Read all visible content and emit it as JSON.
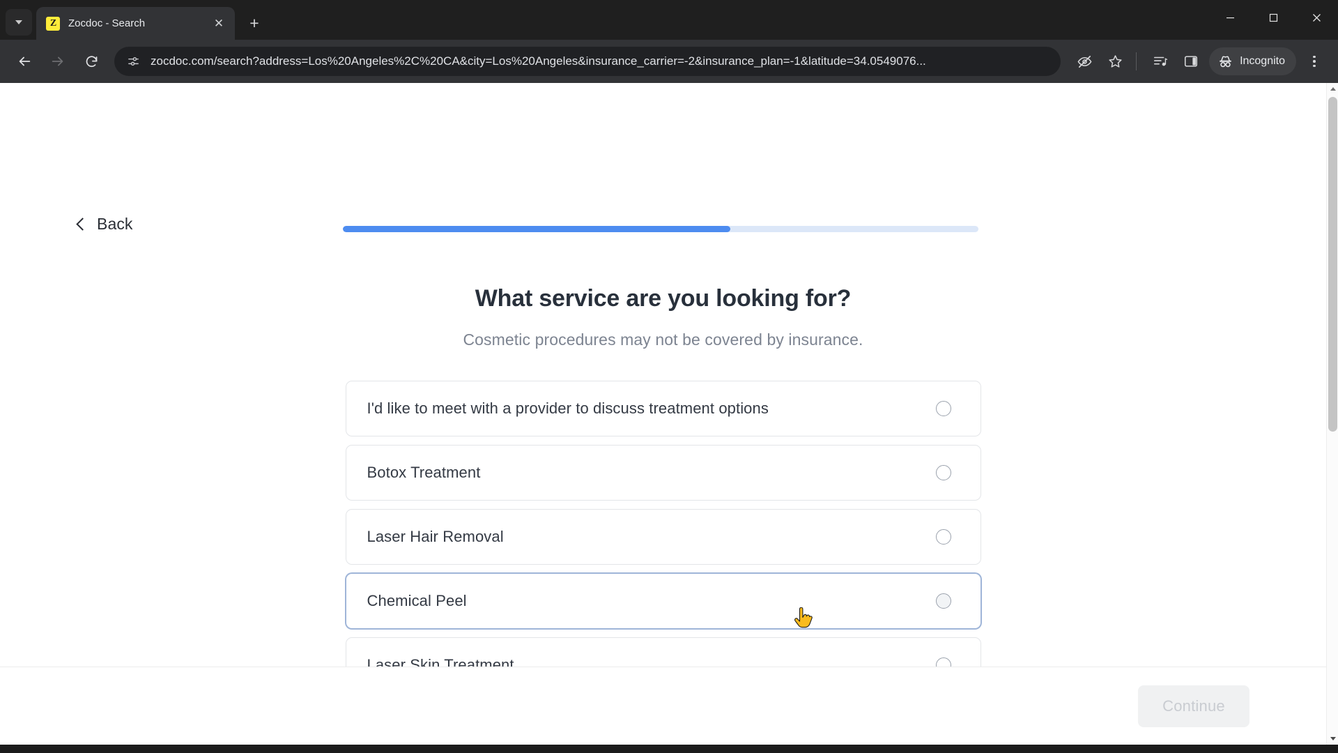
{
  "browser": {
    "tab": {
      "favicon_letter": "Z",
      "title": "Zocdoc - Search",
      "close_icon": "close-icon"
    },
    "new_tab_label": "+",
    "window_controls": {
      "minimize": "minimize-icon",
      "maximize": "maximize-icon",
      "close": "close-icon"
    },
    "toolbar": {
      "back_icon": "back-arrow-icon",
      "forward_icon": "forward-arrow-icon",
      "reload_icon": "reload-icon",
      "site_info_icon": "site-settings-icon",
      "url": "zocdoc.com/search?address=Los%20Angeles%2C%20CA&city=Los%20Angeles&insurance_carrier=-2&insurance_plan=-1&latitude=34.0549076...",
      "tracking_icon": "eye-crossed-icon",
      "bookmark_icon": "star-icon",
      "media_icon": "media-playlist-icon",
      "side_panel_icon": "side-panel-icon",
      "incognito_icon": "incognito-hat-icon",
      "incognito_label": "Incognito",
      "menu_icon": "kebab-menu-icon"
    }
  },
  "page": {
    "back_label": "Back",
    "back_icon": "chevron-left-icon",
    "progress": {
      "percent": 61,
      "fill_color": "#4d8cf0",
      "track_color": "#dce7f8"
    },
    "title": "What service are you looking for?",
    "subtitle": "Cosmetic procedures may not be covered by insurance.",
    "options": [
      {
        "label": "I'd like to meet with a provider to discuss treatment options",
        "selected": false,
        "focused": false
      },
      {
        "label": "Botox Treatment",
        "selected": false,
        "focused": false
      },
      {
        "label": "Laser Hair Removal",
        "selected": false,
        "focused": false
      },
      {
        "label": "Chemical Peel",
        "selected": false,
        "focused": true
      },
      {
        "label": "Laser Skin Treatment",
        "selected": false,
        "focused": false
      },
      {
        "label": "",
        "selected": false,
        "focused": false
      }
    ],
    "continue_label": "Continue",
    "continue_enabled": false
  }
}
